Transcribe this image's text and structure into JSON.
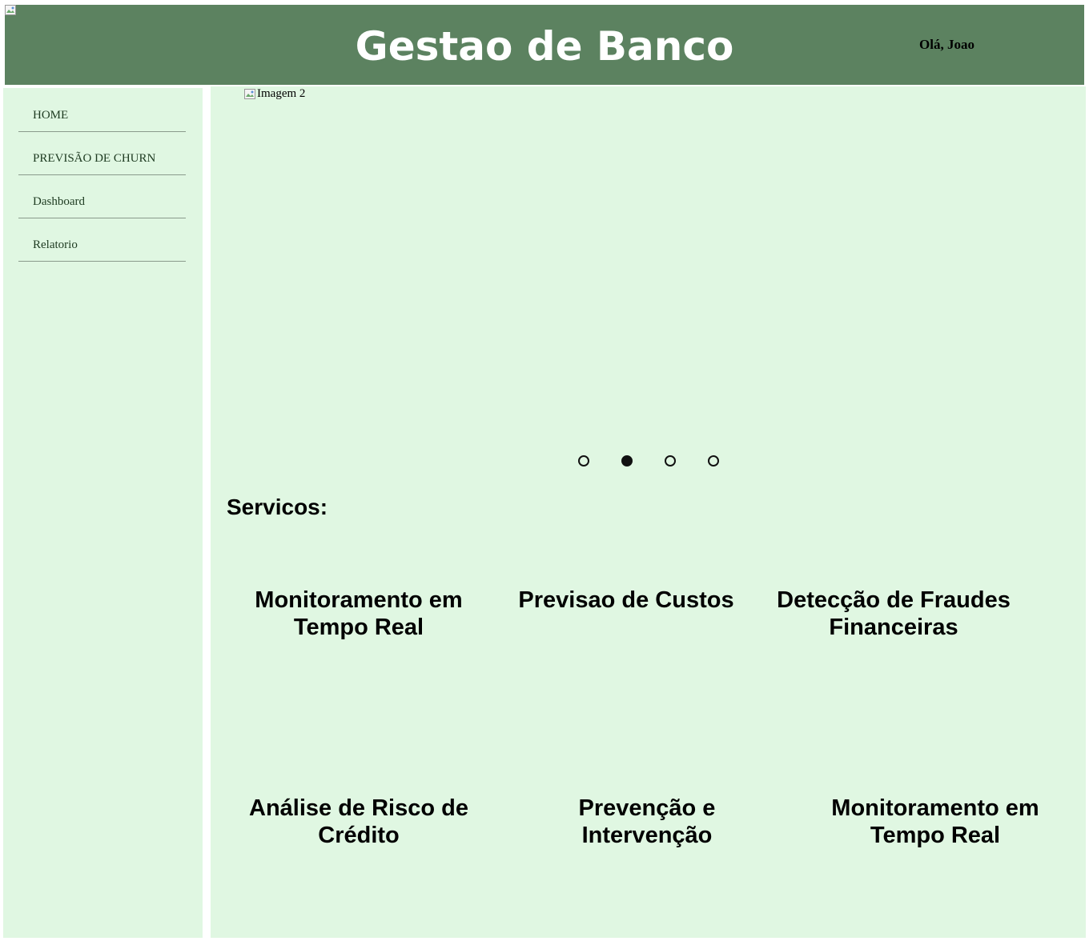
{
  "header": {
    "title": "Gestao de Banco",
    "greeting": "Olá, Joao",
    "background_color": "#5c8260",
    "logo_icon": "broken-image-icon"
  },
  "sidebar": {
    "background_color": "#e0f7e2",
    "items": [
      {
        "label": "HOME"
      },
      {
        "label": "PREVISÃO DE CHURN"
      },
      {
        "label": "Dashboard"
      },
      {
        "label": "Relatorio"
      }
    ]
  },
  "carousel": {
    "image_alt": "Imagem 2",
    "image_icon": "broken-image-icon",
    "slide_count": 4,
    "active_slide": 2
  },
  "services": {
    "title": "Servicos:",
    "items": [
      {
        "label": "Monitoramento em Tempo Real"
      },
      {
        "label": "Previsao de Custos"
      },
      {
        "label": "Detecção de Fraudes Financeiras"
      },
      {
        "label": "Análise de Risco de Crédito"
      },
      {
        "label": "Prevenção e Intervenção"
      },
      {
        "label": "Monitoramento em Tempo Real"
      }
    ]
  }
}
